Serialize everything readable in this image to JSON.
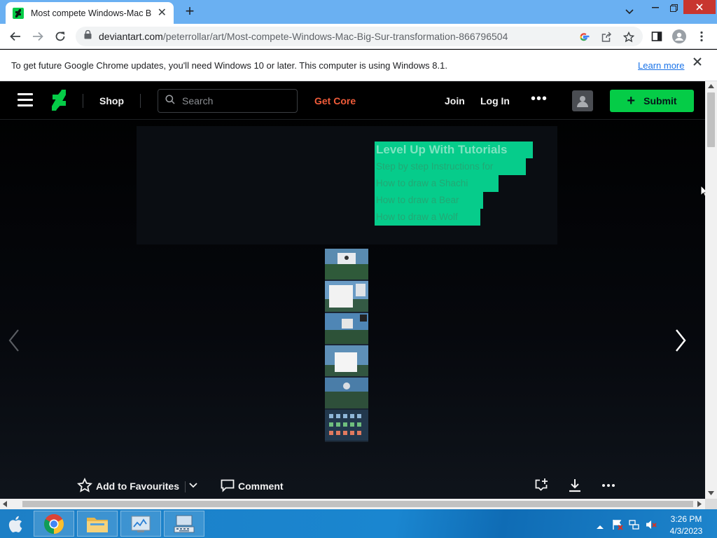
{
  "browser": {
    "tab": {
      "title": "Most compete Windows-Mac Big Sur transformation"
    },
    "url": {
      "host": "deviantart.com",
      "path": "/peterrollar/art/Most-compete-Windows-Mac-Big-Sur-transformation-866796504"
    }
  },
  "infobar": {
    "message": "To get future Google Chrome updates, you'll need Windows 10 or later. This computer is using Windows 8.1.",
    "link": "Learn more"
  },
  "site": {
    "shop": "Shop",
    "search_placeholder": "Search",
    "get_core": "Get Core",
    "join": "Join",
    "login": "Log In",
    "submit": "Submit",
    "accent_color": "#05cc47"
  },
  "ad": {
    "title": "Level Up With Tutorials",
    "lines": [
      "Step by step Instructions for",
      "How to draw a Shachi",
      "How to draw a Bear",
      "How to draw a Wolf"
    ]
  },
  "actions": {
    "favourite": "Add to Favourites",
    "comment": "Comment"
  },
  "taskbar": {
    "time": "3:26 PM",
    "date": "4/3/2023"
  }
}
